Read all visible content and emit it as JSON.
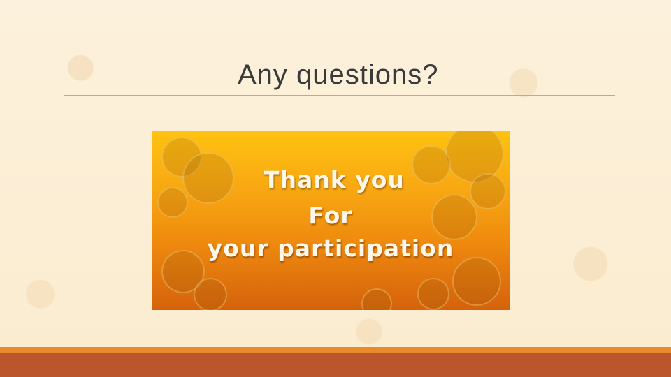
{
  "slide": {
    "title": "Any questions?",
    "image": {
      "line1": "Thank you",
      "line2": "For",
      "line3": "your participation"
    }
  }
}
